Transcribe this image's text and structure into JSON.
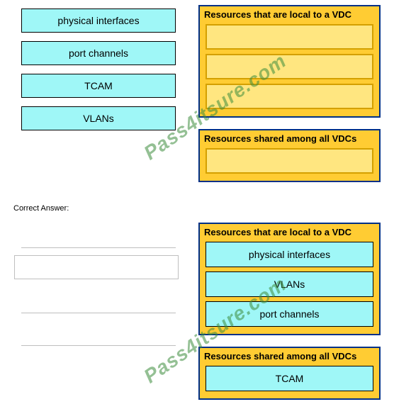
{
  "options": {
    "opt1": "physical interfaces",
    "opt2": "port channels",
    "opt3": "TCAM",
    "opt4": "VLANs"
  },
  "groups": {
    "local_title": "Resources that are local to a VDC",
    "shared_title": "Resources shared among all VDCs"
  },
  "correct_label": "Correct Answer:",
  "answer": {
    "local": [
      "physical interfaces",
      "VLANs",
      "port channels"
    ],
    "shared": [
      "TCAM"
    ]
  },
  "watermark": "Pass4itsure.com"
}
